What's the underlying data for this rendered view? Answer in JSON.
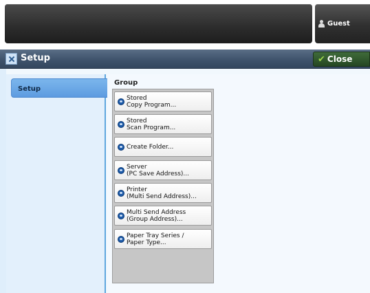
{
  "header": {
    "user_label": "Guest"
  },
  "titlebar": {
    "title": "Setup",
    "close_label": "Close"
  },
  "tabs": [
    {
      "label": "Setup",
      "selected": true
    }
  ],
  "group": {
    "label": "Group",
    "items": [
      {
        "line1": "Stored",
        "line2": "Copy Program..."
      },
      {
        "line1": "Stored",
        "line2": "Scan Program..."
      },
      {
        "line1": "Create Folder...",
        "line2": ""
      },
      {
        "line1": "Server",
        "line2": "(PC Save Address)..."
      },
      {
        "line1": "Printer",
        "line2": "(Multi Send Address)..."
      },
      {
        "line1": "Multi Send Address",
        "line2": "(Group Address)..."
      },
      {
        "line1": "Paper Tray Series /",
        "line2": "Paper Type..."
      }
    ]
  },
  "colors": {
    "accent": "#5d9be0",
    "titlebar": "#3f536c",
    "close": "#254722"
  }
}
